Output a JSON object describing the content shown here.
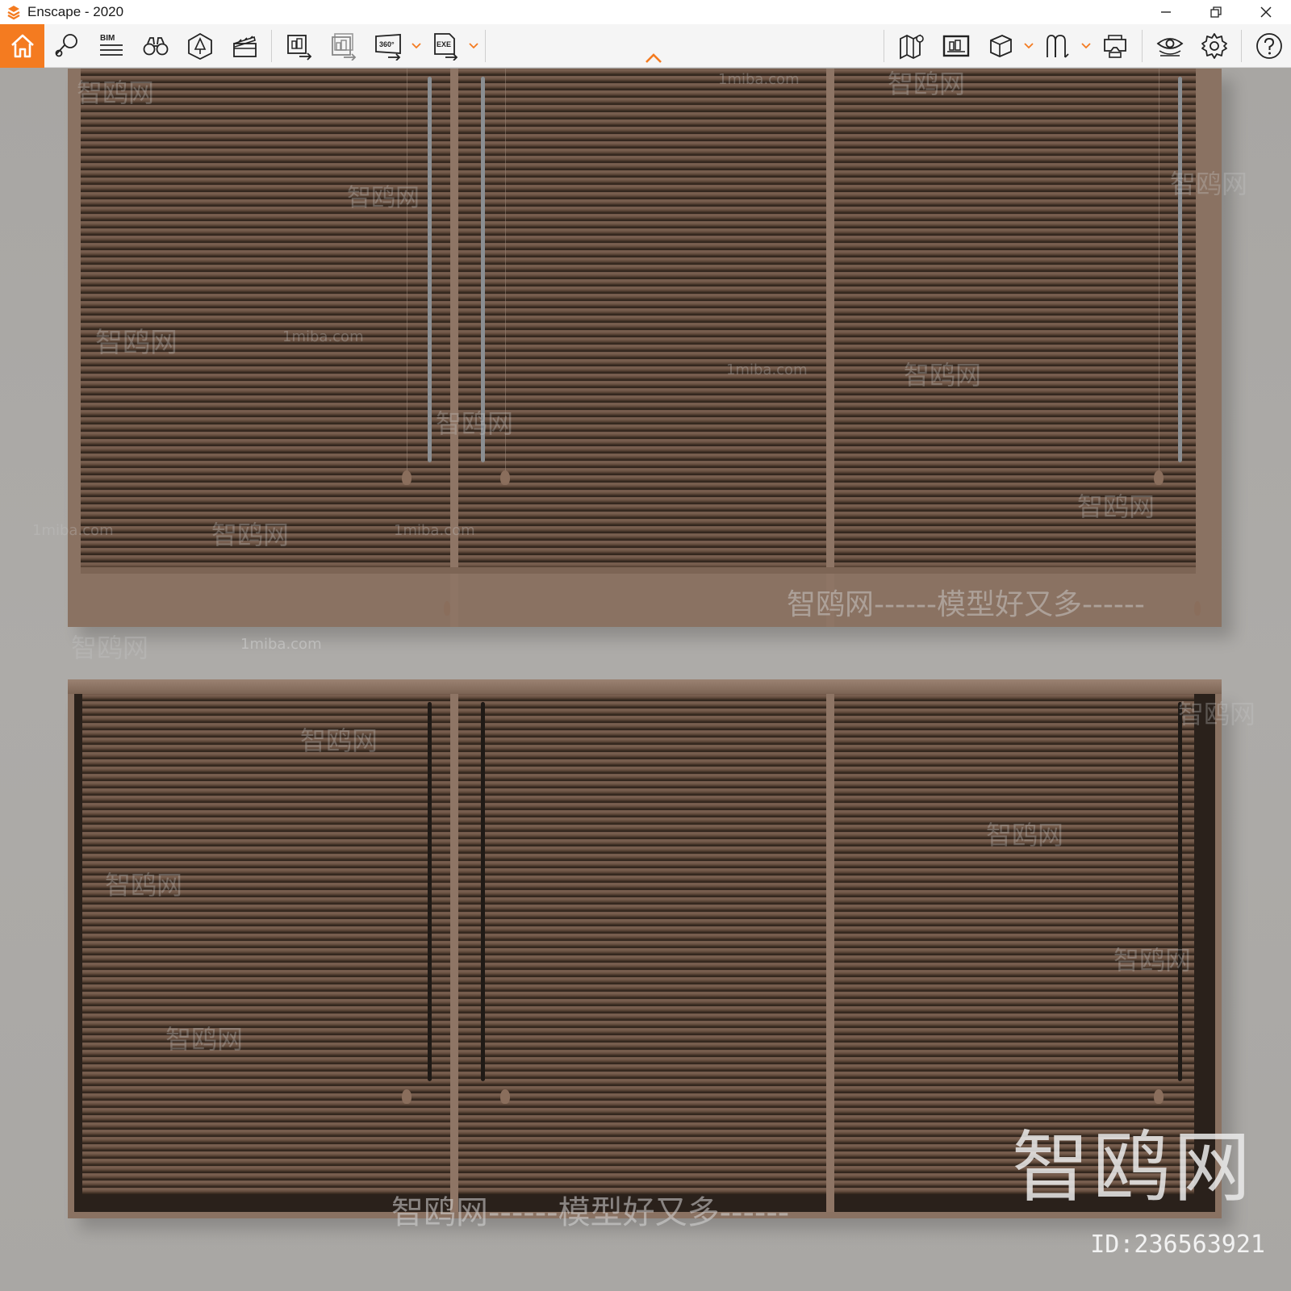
{
  "window": {
    "title": "Enscape - 2020"
  },
  "toolbar": {
    "home": "home-icon",
    "bim_label": "BIM",
    "pano_label": "360°",
    "exe_label": "EXE"
  },
  "watermarks": {
    "site_cn": "智鸥网",
    "site_en": "1miba.com",
    "banner": "智鸥网------模型好又多------",
    "big": "智鸥网",
    "id": "ID:236563921"
  },
  "colors": {
    "accent": "#f47b20",
    "frame": "#8a7262",
    "slat": "#5e4839"
  }
}
